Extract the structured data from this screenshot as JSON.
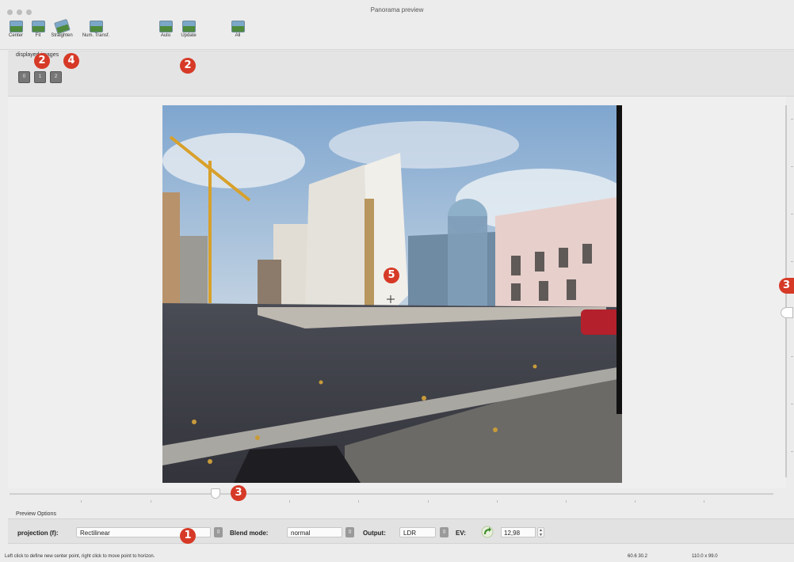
{
  "window": {
    "title": "Panorama preview"
  },
  "toolbar": [
    {
      "label": "Center",
      "icon": "center-icon"
    },
    {
      "label": "Fit",
      "icon": "fit-icon"
    },
    {
      "label": "Straighten",
      "icon": "straighten-icon"
    },
    {
      "label": "Num. Transf.",
      "icon": "numeric-transform-icon"
    },
    {
      "label": "Auto",
      "icon": "auto-icon"
    },
    {
      "label": "Update",
      "icon": "update-icon"
    },
    {
      "label": "All",
      "icon": "all-icon"
    }
  ],
  "display_images": {
    "label": "displayed images",
    "buttons": [
      "0",
      "1",
      "2"
    ]
  },
  "preview_options": {
    "title": "Preview Options",
    "projection_label": "projection (f):",
    "projection_value": "Rectilinear",
    "blend_label": "Blend mode:",
    "blend_value": "normal",
    "output_label": "Output:",
    "output_value": "LDR",
    "ev_label": "EV:",
    "ev_value": "12,98"
  },
  "status": {
    "text": "Left click to define new center point, right click to move point to horizon.",
    "coords": "60.6 30.2",
    "size": "110.0 x 99.0"
  },
  "callouts": {
    "c1": "1",
    "c2a": "2",
    "c2b": "2",
    "c3a": "3",
    "c3b": "3",
    "c4": "4",
    "c5": "5"
  },
  "colors": {
    "callout": "#d63a27",
    "background": "#ececec"
  }
}
